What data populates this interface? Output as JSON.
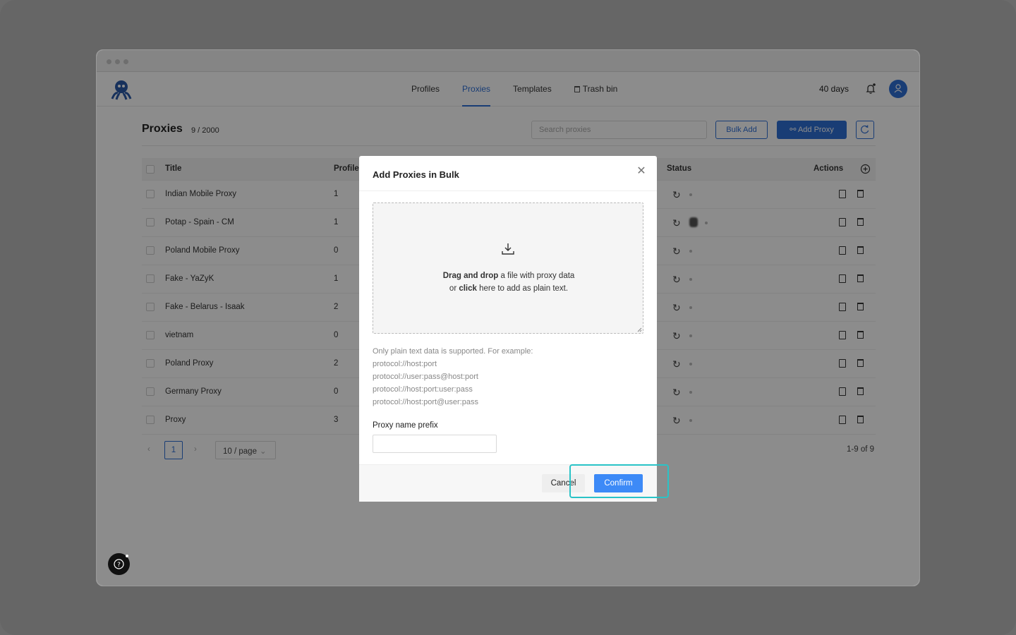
{
  "nav": {
    "tabs": [
      {
        "label": "Profiles"
      },
      {
        "label": "Proxies"
      },
      {
        "label": "Templates"
      },
      {
        "label": "Trash bin"
      }
    ],
    "days": "40 days"
  },
  "page": {
    "title": "Proxies",
    "count": "9 / 2000",
    "search_placeholder": "Search proxies",
    "bulk_add_label": "Bulk Add",
    "add_proxy_label": "Add Proxy"
  },
  "table": {
    "headers": {
      "title": "Title",
      "profiles": "Profiles",
      "status": "Status",
      "actions": "Actions"
    },
    "rows": [
      {
        "title": "Indian Mobile Proxy",
        "profiles": "1"
      },
      {
        "title": "Potap - Spain - CM",
        "profiles": "1"
      },
      {
        "title": "Poland Mobile Proxy",
        "profiles": "0"
      },
      {
        "title": "Fake - YaZyK",
        "profiles": "1"
      },
      {
        "title": "Fake - Belarus - Isaak",
        "profiles": "2"
      },
      {
        "title": "vietnam",
        "profiles": "0"
      },
      {
        "title": "Poland Proxy",
        "profiles": "2"
      },
      {
        "title": "Germany Proxy",
        "profiles": "0"
      },
      {
        "title": "Proxy",
        "profiles": "3"
      }
    ]
  },
  "pagination": {
    "current_page": "1",
    "page_size": "10 / page",
    "range": "1-9 of 9"
  },
  "modal": {
    "title": "Add Proxies in Bulk",
    "dropzone_line1_bold": "Drag and drop",
    "dropzone_line1_rest": " a file with proxy data",
    "dropzone_line2_pre": "or ",
    "dropzone_line2_bold": "click",
    "dropzone_line2_rest": " here to add as plain text.",
    "hint_lines": [
      "Only plain text data is supported. For example:",
      "protocol://host:port",
      "protocol://user:pass@host:port",
      "protocol://host:port:user:pass",
      "protocol://host:port@user:pass"
    ],
    "prefix_label": "Proxy name prefix",
    "prefix_value": "",
    "cancel_label": "Cancel",
    "confirm_label": "Confirm"
  },
  "colors": {
    "accent": "#2f6fd6",
    "confirm": "#3d8af7",
    "highlight": "#2ac3c7"
  }
}
